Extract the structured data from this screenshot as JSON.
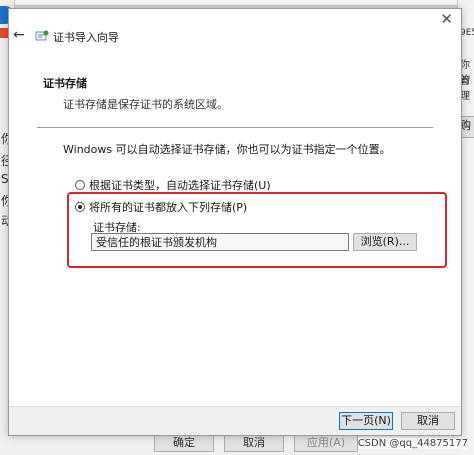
{
  "background": {
    "left_glyphs": [
      "你",
      "径",
      "S",
      "你",
      "动"
    ],
    "right_glyphs": [
      "9E5",
      "你的",
      "管理"
    ],
    "right_button_label": "购",
    "bottom_buttons": [
      "确定",
      "取消",
      "应用(A)"
    ]
  },
  "dialog": {
    "title": "证书导入向导",
    "close_label": "✕",
    "header": {
      "title": "证书存储",
      "description": "证书存储是保存证书的系统区域。"
    },
    "body_text": "Windows 可以自动选择证书存储，你也可以为证书指定一个位置。",
    "radio_auto": "根据证书类型，自动选择证书存储(U)",
    "radio_manual": "将所有的证书都放入下列存储(P)",
    "store_label": "证书存储:",
    "store_value": "受信任的根证书颁发机构",
    "browse_label": "浏览(R)...",
    "next_label": "下一页(N)",
    "cancel_label": "取消"
  },
  "watermark": "CSDN @qq_44875177",
  "colors": {
    "highlight": "#e0242b",
    "primary_border": "#0078d7"
  }
}
